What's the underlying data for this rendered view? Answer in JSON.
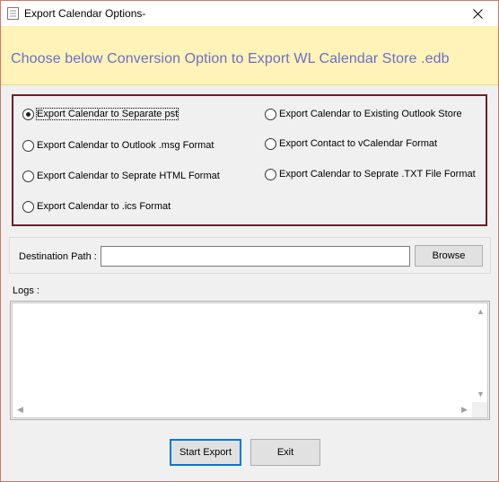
{
  "window": {
    "title": "Export Calendar Options-",
    "close_glyph": "✕"
  },
  "banner": {
    "text": "Choose below Conversion Option to Export WL Calendar Store .edb",
    "color": "#6b6ec9",
    "background": "#fff3b8"
  },
  "options": {
    "border_color": "#6b1f2a",
    "items": [
      {
        "label": "Export Calendar to Separate pst",
        "checked": true
      },
      {
        "label": "Export Calendar to Outlook .msg Format",
        "checked": false
      },
      {
        "label": "Export Calendar to Seprate HTML Format",
        "checked": false
      },
      {
        "label": "Export Calendar to .ics Format",
        "checked": false
      },
      {
        "label": "Export Calendar to Existing Outlook Store",
        "checked": false
      },
      {
        "label": "Export Contact to vCalendar Format",
        "checked": false
      },
      {
        "label": "Export Calendar to Seprate .TXT File Format",
        "checked": false
      }
    ]
  },
  "destination": {
    "label": "Destination Path :",
    "value": "",
    "browse_label": "Browse"
  },
  "logs": {
    "label": "Logs :",
    "content": ""
  },
  "actions": {
    "start_label": "Start Export",
    "exit_label": "Exit",
    "focus_color": "#0078d7"
  }
}
